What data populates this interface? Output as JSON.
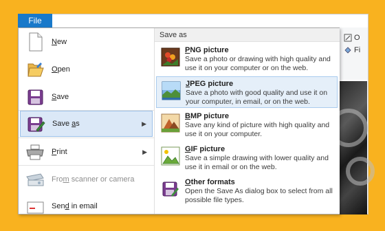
{
  "file_tab": "File",
  "ribbon_edge": [
    {
      "label": "O",
      "icon": "pencil-icon"
    },
    {
      "label": "Fi",
      "icon": "fill-icon"
    }
  ],
  "left_menu": [
    {
      "key": "new",
      "label": "New",
      "accel": "N",
      "rest": "ew",
      "pre": "",
      "icon": "new-document-icon"
    },
    {
      "key": "open",
      "label": "Open",
      "accel": "O",
      "rest": "pen",
      "pre": "",
      "icon": "open-folder-icon"
    },
    {
      "key": "save",
      "label": "Save",
      "accel": "S",
      "rest": "ave",
      "pre": "",
      "icon": "save-disk-icon"
    },
    {
      "key": "save_as",
      "label": "Save as",
      "pre": "Save ",
      "accel": "a",
      "rest": "s",
      "icon": "save-as-icon",
      "has_submenu": true
    },
    {
      "key": "print",
      "label": "Print",
      "accel": "P",
      "rest": "rint",
      "pre": "",
      "icon": "printer-icon",
      "has_submenu": true
    },
    {
      "key": "scanner",
      "label": "From scanner or camera",
      "pre": "Fro",
      "accel": "m",
      "rest": " scanner or camera",
      "icon": "scanner-icon",
      "disabled": true
    },
    {
      "key": "email",
      "label": "Send in email",
      "pre": "Sen",
      "accel": "d",
      "rest": " in email",
      "icon": "email-icon"
    }
  ],
  "submenu": {
    "title": "Save as",
    "options": [
      {
        "key": "png",
        "accel": "P",
        "rest": "NG picture",
        "desc": "Save a photo or drawing with high quality and use it on your computer or on the web.",
        "icon": "png-picture-icon"
      },
      {
        "key": "jpeg",
        "accel": "J",
        "rest": "PEG picture",
        "desc": "Save a photo with good quality and use it on your computer, in email, or on the web.",
        "icon": "jpeg-picture-icon",
        "active": true
      },
      {
        "key": "bmp",
        "accel": "B",
        "rest": "MP picture",
        "desc": "Save any kind of picture with high quality and use it on your computer.",
        "icon": "bmp-picture-icon"
      },
      {
        "key": "gif",
        "accel": "G",
        "rest": "IF picture",
        "desc": "Save a simple drawing with lower quality and use it in email or on the web.",
        "icon": "gif-picture-icon"
      },
      {
        "key": "other",
        "accel": "O",
        "rest": "ther formats",
        "desc": "Open the Save As dialog box to select from all possible file types.",
        "icon": "other-formats-icon"
      }
    ]
  },
  "colors": {
    "background": "#f9b21f",
    "file_tab": "#1979ca",
    "highlight": "#dbe8f7",
    "highlight_border": "#9cc0e8"
  }
}
